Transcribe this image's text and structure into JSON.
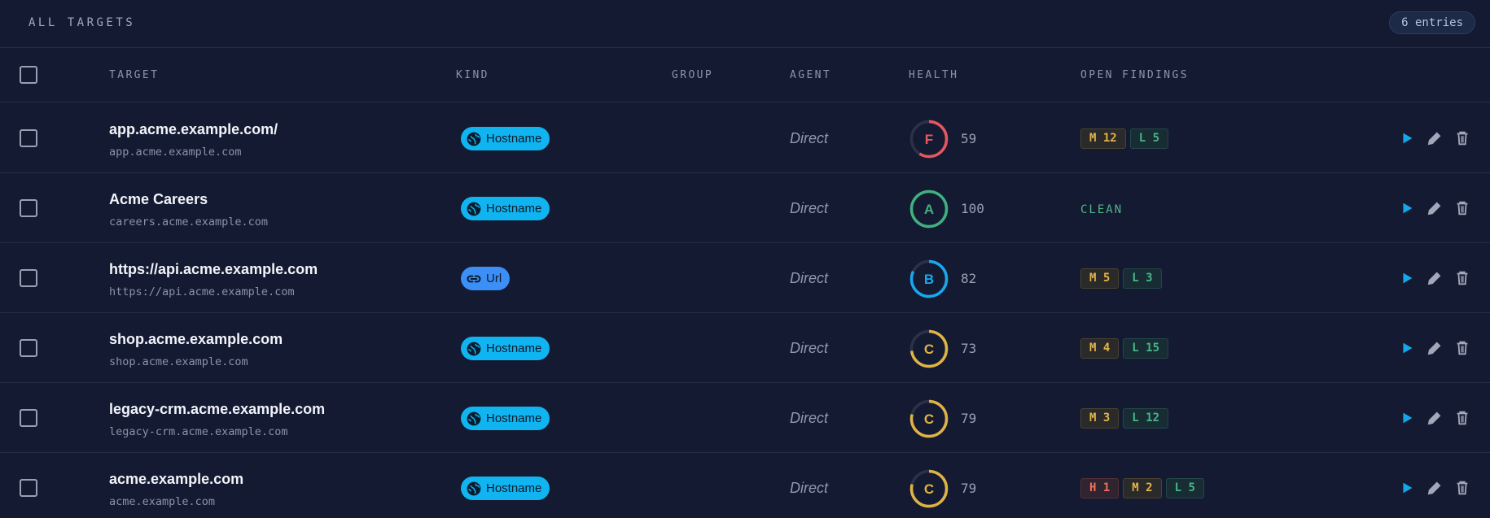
{
  "header": {
    "title": "ALL TARGETS",
    "entries_label": "6 entries"
  },
  "columns": {
    "target": "TARGET",
    "kind": "KIND",
    "group": "GROUP",
    "agent": "AGENT",
    "health": "HEALTH",
    "findings": "OPEN FINDINGS"
  },
  "colors": {
    "hostname": "#0fb4f0",
    "url": "#3b8ff6",
    "grade_F": "#e8575f",
    "grade_A": "#40b07f",
    "grade_B": "#18a8ee",
    "grade_C": "#dfb445",
    "track": "#2b3147"
  },
  "rows": [
    {
      "name": "app.acme.example.com/",
      "sub": "app.acme.example.com",
      "kind": "Hostname",
      "kind_icon": "globe-icon",
      "group": "",
      "agent": "Direct",
      "grade": "F",
      "score": 59,
      "findings": [
        {
          "sev": "M",
          "text": "M 12"
        },
        {
          "sev": "L",
          "text": "L 5"
        }
      ],
      "clean": ""
    },
    {
      "name": "Acme Careers",
      "sub": "careers.acme.example.com",
      "kind": "Hostname",
      "kind_icon": "globe-icon",
      "group": "",
      "agent": "Direct",
      "grade": "A",
      "score": 100,
      "findings": [],
      "clean": "CLEAN"
    },
    {
      "name": "https://api.acme.example.com",
      "sub": "https://api.acme.example.com",
      "kind": "Url",
      "kind_icon": "link-icon",
      "group": "",
      "agent": "Direct",
      "grade": "B",
      "score": 82,
      "findings": [
        {
          "sev": "M",
          "text": "M 5"
        },
        {
          "sev": "L",
          "text": "L 3"
        }
      ],
      "clean": ""
    },
    {
      "name": "shop.acme.example.com",
      "sub": "shop.acme.example.com",
      "kind": "Hostname",
      "kind_icon": "globe-icon",
      "group": "",
      "agent": "Direct",
      "grade": "C",
      "score": 73,
      "findings": [
        {
          "sev": "M",
          "text": "M 4"
        },
        {
          "sev": "L",
          "text": "L 15"
        }
      ],
      "clean": ""
    },
    {
      "name": "legacy-crm.acme.example.com",
      "sub": "legacy-crm.acme.example.com",
      "kind": "Hostname",
      "kind_icon": "globe-icon",
      "group": "",
      "agent": "Direct",
      "grade": "C",
      "score": 79,
      "findings": [
        {
          "sev": "M",
          "text": "M 3"
        },
        {
          "sev": "L",
          "text": "L 12"
        }
      ],
      "clean": ""
    },
    {
      "name": "acme.example.com",
      "sub": "acme.example.com",
      "kind": "Hostname",
      "kind_icon": "globe-icon",
      "group": "",
      "agent": "Direct",
      "grade": "C",
      "score": 79,
      "findings": [
        {
          "sev": "H",
          "text": "H 1"
        },
        {
          "sev": "M",
          "text": "M 2"
        },
        {
          "sev": "L",
          "text": "L 5"
        }
      ],
      "clean": ""
    }
  ]
}
